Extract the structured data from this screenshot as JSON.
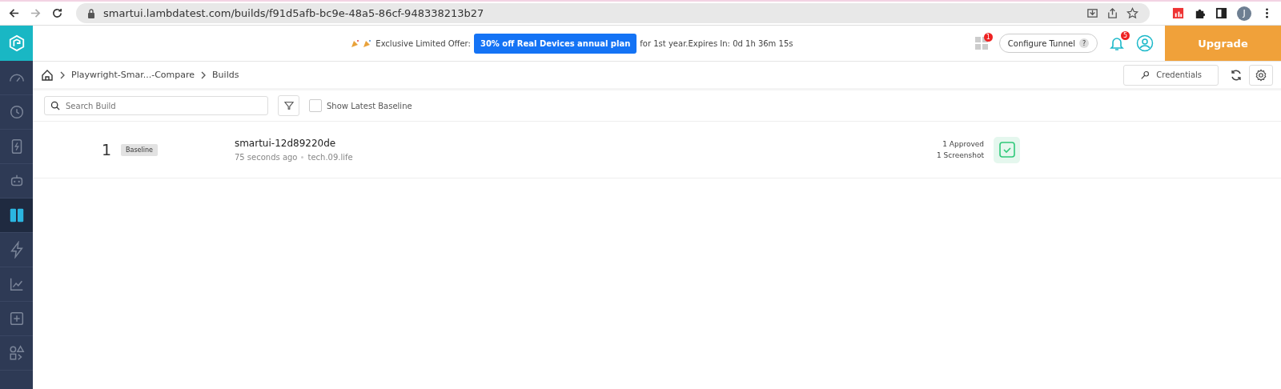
{
  "browser": {
    "url": "smartui.lambdatest.com/builds/f91d5afb-bc9e-48a5-86cf-948338213b27",
    "avatar": "J"
  },
  "header": {
    "offer_label": "Exclusive Limited Offer:",
    "offer_button": "30% off Real Devices annual plan",
    "offer_suffix": "for 1st year.Expires In: 0d 1h 36m 15s",
    "apps_badge": "1",
    "tunnel": "Configure Tunnel",
    "tunnel_help": "?",
    "notifications_badge": "5",
    "upgrade": "Upgrade"
  },
  "sidebar": {
    "items": [
      {
        "kind": "gauge",
        "selected": false
      },
      {
        "kind": "clock",
        "selected": false
      },
      {
        "kind": "mobile",
        "selected": false
      },
      {
        "kind": "robot",
        "selected": false
      },
      {
        "kind": "compare",
        "selected": true
      },
      {
        "kind": "bolt",
        "selected": false
      },
      {
        "kind": "chart",
        "selected": false
      },
      {
        "kind": "plus",
        "selected": false
      },
      {
        "kind": "shapes",
        "selected": false
      }
    ]
  },
  "breadcrumb": [
    "Playwright-Smar...-Compare",
    "Builds"
  ],
  "toolbar": {
    "credentials": "Credentials"
  },
  "filters": {
    "search": {
      "placeholder": "Search Build"
    },
    "latest_baseline": {
      "label": "Show Latest Baseline",
      "checked": false
    }
  },
  "builds": [
    {
      "number": "1",
      "tag": "Baseline",
      "name": "smartui-12d89220de",
      "time": "75 seconds ago",
      "author": "tech.09.life",
      "approved": "1 Approved",
      "screenshots": "1 Screenshot",
      "approved_state": true
    }
  ]
}
